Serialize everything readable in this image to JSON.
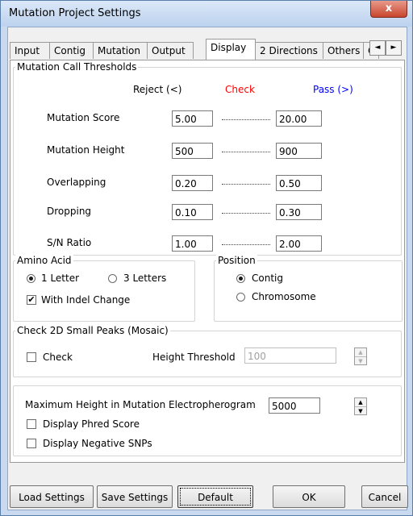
{
  "window": {
    "title": "Mutation Project Settings",
    "close_label": "x"
  },
  "tabs": [
    "Input",
    "Contig",
    "Mutation",
    "Output",
    "Display",
    "2 Directions",
    "Others",
    "C"
  ],
  "tab_scroll": {
    "left": "◄",
    "right": "►"
  },
  "thresholds": {
    "group_label": "Mutation Call Thresholds",
    "header_reject": "Reject (<)",
    "header_check": "Check",
    "header_pass": "Pass (>)",
    "colors": {
      "check": "#ff0000",
      "pass": "#0000ff"
    },
    "rows": [
      {
        "label": "Mutation Score",
        "reject": "5.00",
        "pass": "20.00"
      },
      {
        "label": "Mutation Height",
        "reject": "500",
        "pass": "900"
      },
      {
        "label": "Overlapping",
        "reject": "0.20",
        "pass": "0.50"
      },
      {
        "label": "Dropping",
        "reject": "0.10",
        "pass": "0.30"
      },
      {
        "label": "S/N Ratio",
        "reject": "1.00",
        "pass": "2.00"
      }
    ]
  },
  "amino_acid": {
    "group_label": "Amino Acid",
    "option_1": "1 Letter",
    "option_3": "3 Letters",
    "indel_label": "With Indel Change",
    "selected": "1 Letter",
    "indel_checked": true
  },
  "position": {
    "group_label": "Position",
    "option_contig": "Contig",
    "option_chromosome": "Chromosome",
    "selected": "Contig"
  },
  "small_peaks": {
    "group_label": "Check 2D Small Peaks (Mosaic)",
    "check_label": "Check",
    "checked": false,
    "height_label": "Height Threshold",
    "height_value": "100"
  },
  "display_opts": {
    "max_height_label": "Maximum Height in Mutation Electropherogram",
    "max_height_value": "5000",
    "phred_label": "Display Phred Score",
    "negative_label": "Display Negative SNPs"
  },
  "buttons": {
    "load": "Load Settings",
    "save": "Save Settings",
    "default": "Default",
    "ok": "OK",
    "cancel": "Cancel"
  }
}
